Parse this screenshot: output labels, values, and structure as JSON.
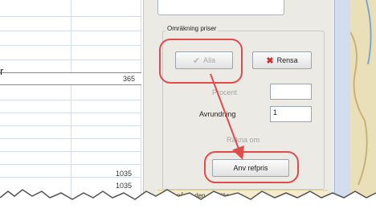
{
  "left_fragment": "r",
  "grid": {
    "value_top": "365",
    "value_bottom_1": "1035",
    "value_bottom_2": "1035"
  },
  "group": {
    "title": "Omräkning priser"
  },
  "buttons": {
    "alla_label": "Alla",
    "rensa_label": "Rensa",
    "anv_label": "Anv refpris"
  },
  "fields": {
    "procent_label": "Procent",
    "procent_value": "",
    "avrundning_label": "Avrundning",
    "avrundning_value": "1",
    "rakna_label": "Räkna om"
  },
  "bottom_text": "Tänk på att den som läses in...",
  "colors": {
    "annotation_red": "#e04b4b",
    "panel_bg": "#eceae5"
  }
}
